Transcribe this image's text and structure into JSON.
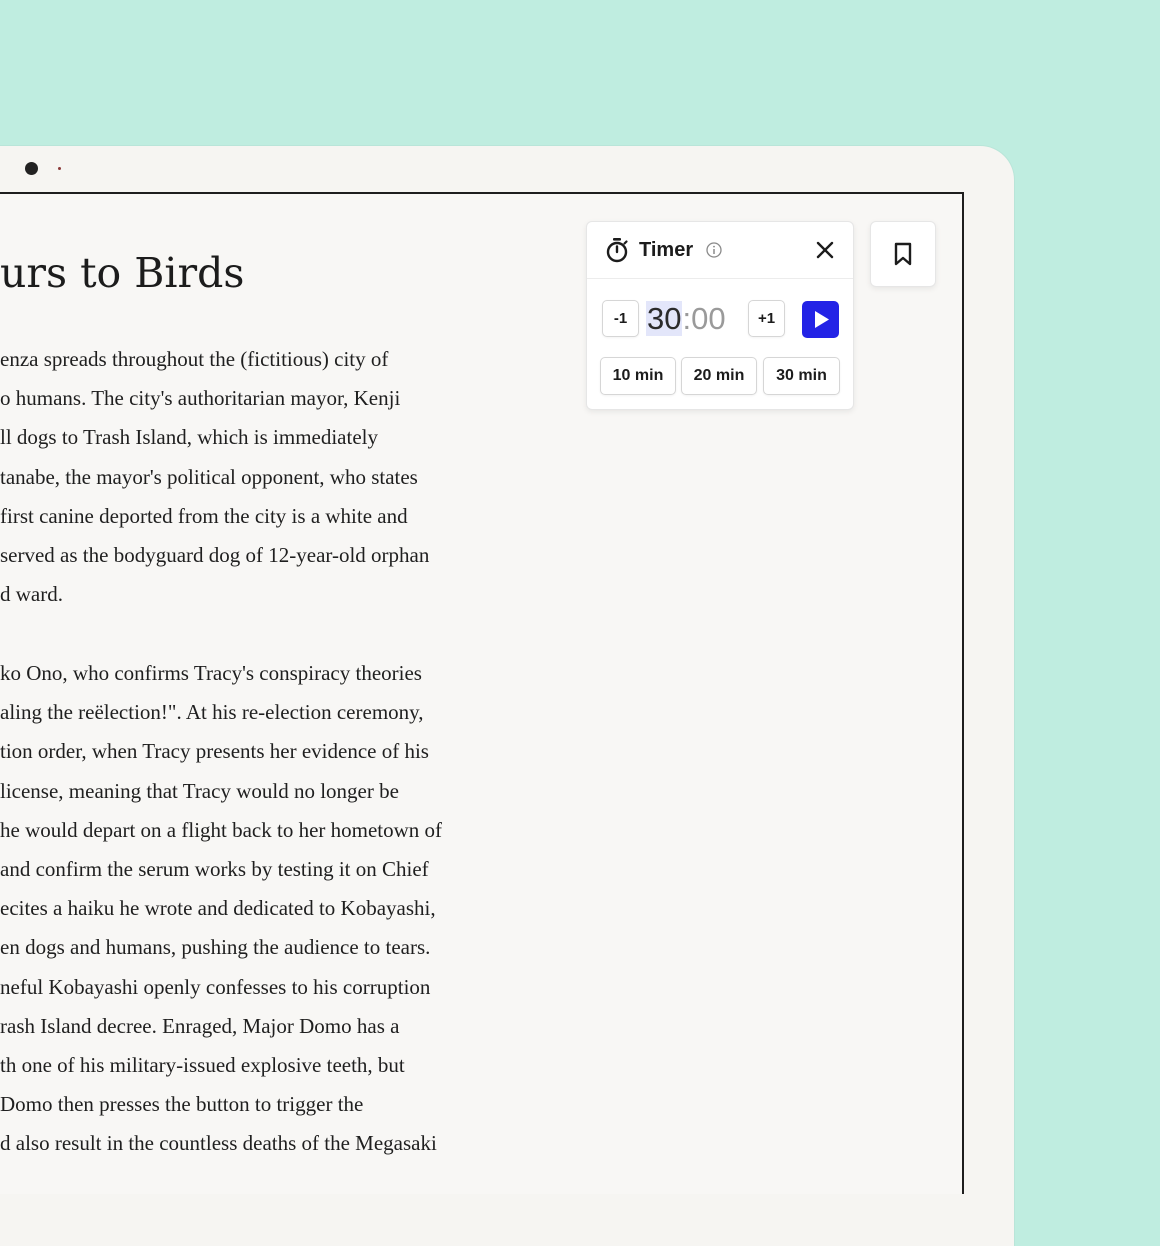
{
  "reader": {
    "title": "urs to Birds",
    "paragraph1": [
      "enza spreads throughout the (fictitious) city of",
      "o humans. The city's authoritarian mayor, Kenji",
      "ll dogs to Trash Island, which is immediately",
      "tanabe, the mayor's political opponent, who states",
      "first canine deported from the city is a white and",
      "served as the bodyguard dog of 12-year-old orphan",
      "d ward."
    ],
    "paragraph2": [
      "ko Ono, who confirms Tracy's conspiracy theories",
      "aling the reëlection!\". At his re-election ceremony,",
      "tion order, when Tracy presents her evidence of his",
      " license, meaning that Tracy would no longer be",
      "he would depart on a flight back to her hometown of",
      " and confirm the serum works by testing it on Chief",
      "ecites a haiku he wrote and dedicated to Kobayashi,",
      "en dogs and humans, pushing the audience to tears.",
      "neful Kobayashi openly confesses to his corruption",
      "rash Island decree. Enraged, Major Domo has a",
      "th one of his military-issued explosive teeth, but",
      "Domo then presses the button to trigger the",
      "d also result in the countless deaths of the Megasaki"
    ]
  },
  "timer": {
    "title": "Timer",
    "minus_label": "-1",
    "plus_label": "+1",
    "minutes": "30",
    "separator": ":",
    "seconds": "00",
    "presets": [
      "10 min",
      "20 min",
      "30 min"
    ],
    "icons": {
      "stopwatch": "stopwatch-icon",
      "info": "info-icon",
      "close": "close-icon",
      "play": "play-icon"
    },
    "accent_color": "#2323e6"
  },
  "bookmark": {
    "icon": "bookmark-icon"
  },
  "colors": {
    "background": "#bfede0",
    "page": "#f8f7f5"
  }
}
